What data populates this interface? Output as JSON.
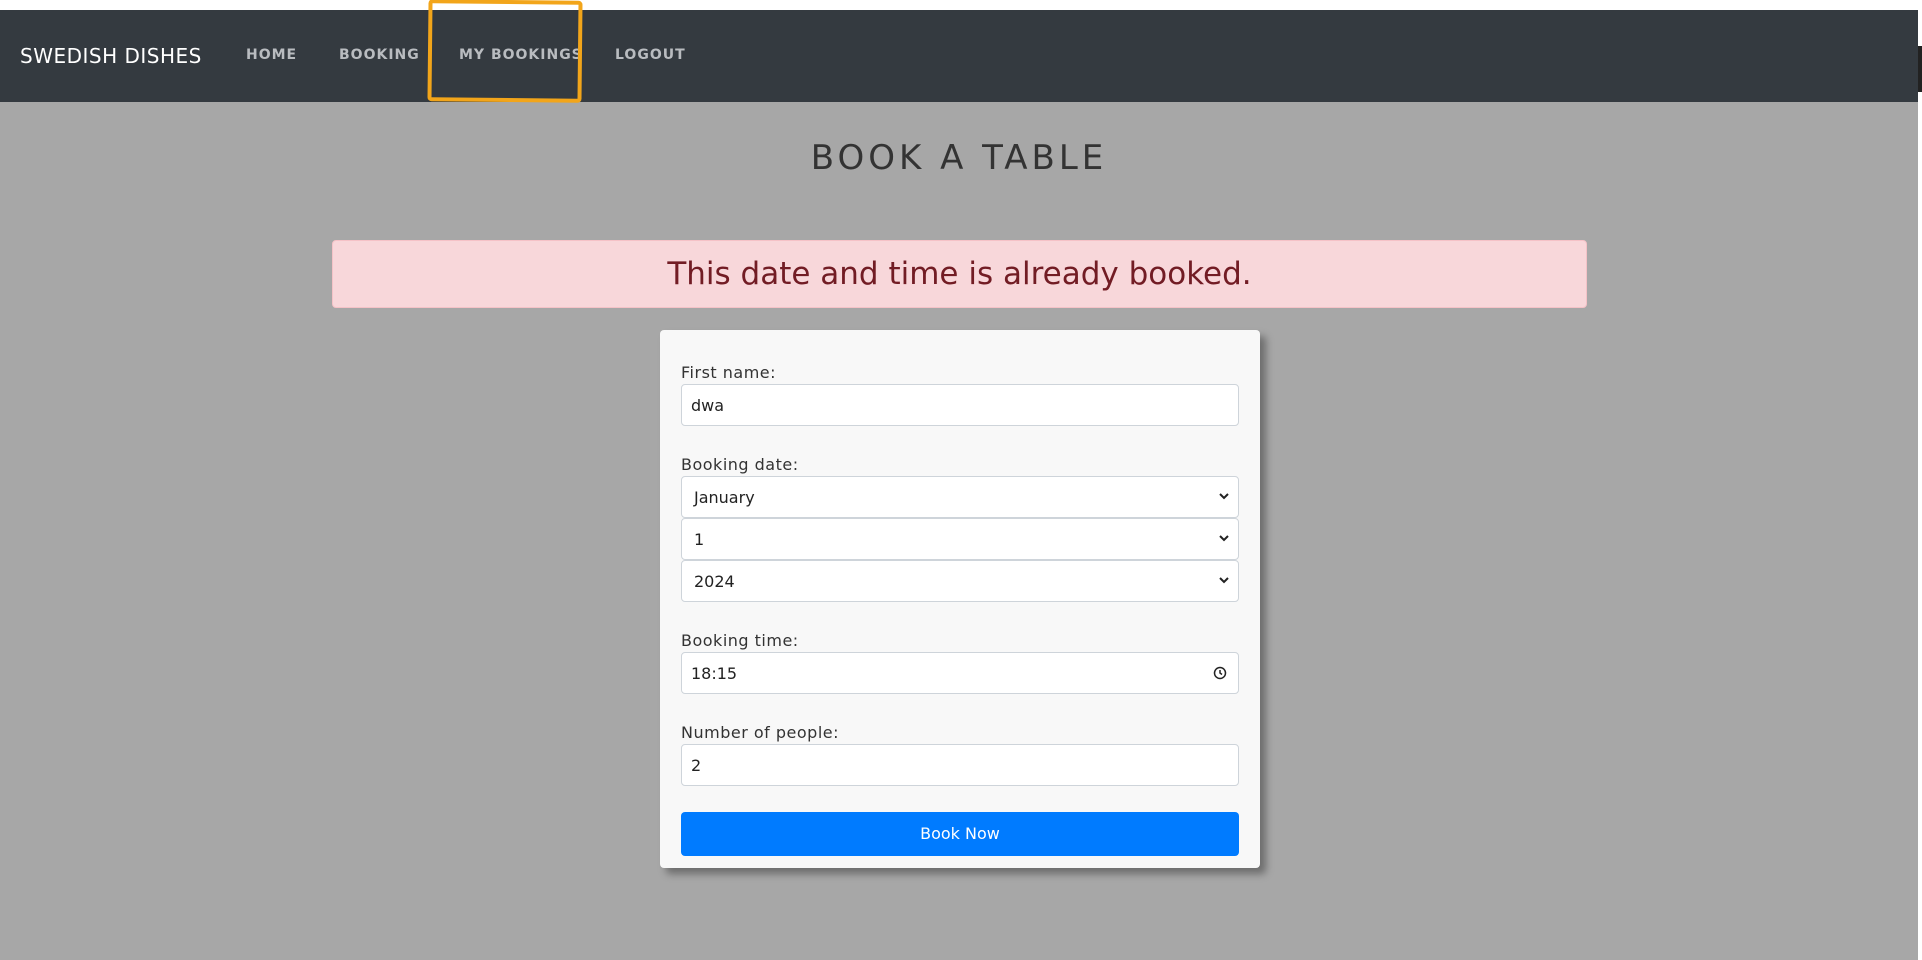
{
  "navbar": {
    "brand": "SWEDISH DISHES",
    "links": [
      {
        "label": "HOME"
      },
      {
        "label": "BOOKING"
      },
      {
        "label": "MY BOOKINGS"
      },
      {
        "label": "LOGOUT"
      }
    ],
    "highlight_color": "#f2a51a"
  },
  "page": {
    "title": "BOOK A TABLE"
  },
  "alert": {
    "message": "This date and time is already booked.",
    "background": "#f8d7da"
  },
  "form": {
    "first_name": {
      "label": "First name:",
      "value": "dwa"
    },
    "booking_date": {
      "label": "Booking date:",
      "month": "January",
      "day": "1",
      "year": "2024"
    },
    "booking_time": {
      "label": "Booking time:",
      "value": "18:15"
    },
    "people": {
      "label": "Number of people:",
      "value": "2"
    },
    "submit_label": "Book Now",
    "submit_color": "#007bff"
  },
  "icons": {
    "dropdown": "chevron-down-icon",
    "time": "clock-icon"
  }
}
